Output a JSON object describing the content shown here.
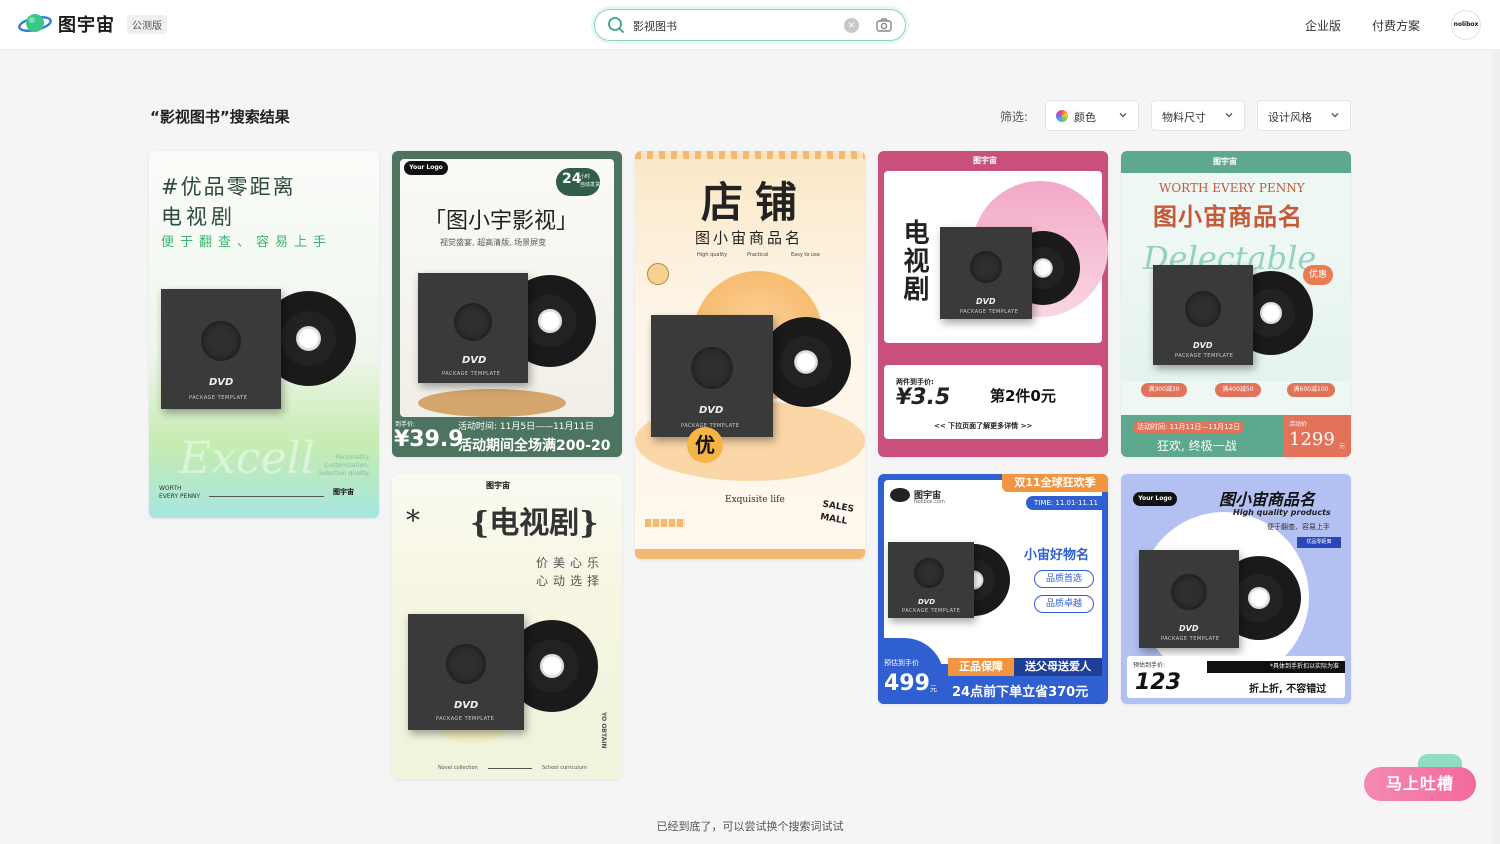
{
  "header": {
    "brand": "图宇宙",
    "badge": "公测版",
    "search_value": "影视图书",
    "nav_enterprise": "企业版",
    "nav_pricing": "付费方案",
    "avatar_text": "nolibox"
  },
  "results": {
    "title": "“影视图书”搜索结果",
    "filter_label": "筛选:",
    "filters": [
      "颜色",
      "物料尺寸",
      "设计风格"
    ]
  },
  "cards": {
    "c1": {
      "title1": "#优品零距离",
      "title2": "电视剧",
      "subtitle": "便于翻查、容易上手",
      "side": "Personality\nCustomization,\nSelection quality",
      "bottom": "WORTH\nEVERY PENNY",
      "script": "Excell",
      "brand": "图宇宙"
    },
    "c2": {
      "logo": "Your Logo",
      "badge_num": "24",
      "badge_txt": "小时\n自动发货",
      "title": "「图小宇影视」",
      "subtitle": "视觉盛宴, 超高清版, 场景屏变",
      "price_label": "到手价:",
      "price": "¥39.9",
      "date": "活动时间: 11月5日——11月11日",
      "promo": "活动期间全场满200-20"
    },
    "c3": {
      "title": "店铺",
      "subtitle": "图小宙商品名",
      "tag1": "High quality",
      "tag2": "Practical",
      "tag3": "Easy to use",
      "you": "优",
      "exquisite": "Exquisite life",
      "sales": "SALES\nMALL"
    },
    "c4": {
      "brand": "图宇宙",
      "vert": "电视剧",
      "price_label": "两件到手价:",
      "price": "¥3.5",
      "second": "第2件0元",
      "swipe": "<< 下拉页面了解更多详情 >>"
    },
    "c5": {
      "brand": "图宇宙",
      "en": "WORTH EVERY PENNY",
      "title": "图小宙商品名",
      "script": "Delectable",
      "youhui": "优惠",
      "coupon1": "满300减30",
      "coupon2": "满400减50",
      "coupon3": "满600减100",
      "date": "活动时间: 11月11日—11月12日",
      "slogan": "狂欢, 终极一战",
      "price_label": "活动价",
      "price": "1299",
      "unit": "元"
    },
    "c6": {
      "brand": "图宇宙",
      "title": "{电视剧}",
      "poem1": "价美心乐",
      "poem2": "心动选择",
      "side": "YO OBTAIN",
      "left": "Novel collection",
      "right": "School curriculum"
    },
    "c7": {
      "brand": "图宇宙",
      "brand_sub": "Nolibox.com",
      "badge": "双11全球狂欢季",
      "time": "TIME: 11.01-11.11",
      "name": "小宙好物名",
      "tag1": "品质首选",
      "tag2": "品质卓越",
      "price_label": "预估到手价",
      "price": "499",
      "unit": "元",
      "label1": "正品保障",
      "label2": "送父母送爱人",
      "promo": "24点前下单立省370元"
    },
    "c8": {
      "logo": "Your Logo",
      "title": "图小宙商品名",
      "sub1": "High quality products",
      "sub2": "便于翻查、容易上手",
      "badge": "优品零距离",
      "price_label": "预估到手价:",
      "note": "*具体到手折扣以实际为准",
      "price": "123",
      "slogan": "折上折, 不容错过"
    },
    "dvd": "DVD",
    "package": "PACKAGE TEMPLATE"
  },
  "footer": {
    "end_message": "已经到底了，可以尝试换个搜索词试试"
  },
  "feedback": {
    "label": "马上吐槽"
  }
}
